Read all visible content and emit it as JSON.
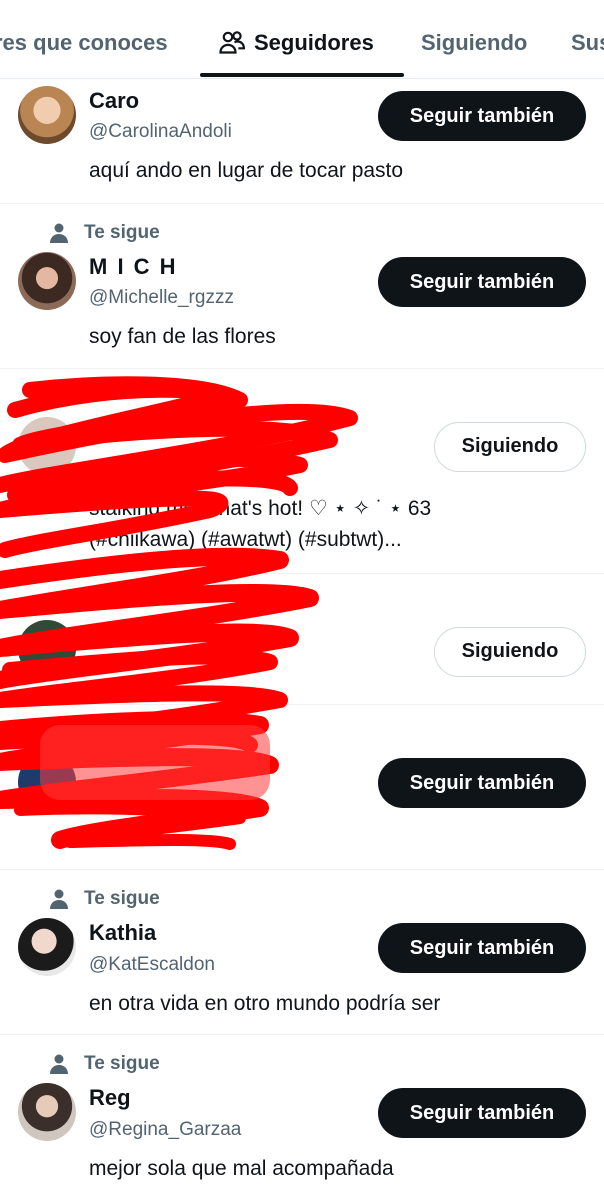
{
  "tabs": [
    {
      "label": "res que conoces"
    },
    {
      "label": "Seguidores",
      "icon": "people-icon",
      "selected": true
    },
    {
      "label": "Siguiendo"
    },
    {
      "label": "Sus"
    }
  ],
  "follows_you_label": "Te sigue",
  "rows": [
    {
      "name": "Caro",
      "handle": "@CarolinaAndoli",
      "button": "Seguir también",
      "bio": "aquí ando en lugar de tocar pasto"
    },
    {
      "follows_you": "Te sigue",
      "name": "M I C H",
      "handle": "@Michelle_rgzzz",
      "button": "Seguir también",
      "bio": "soy fan de las flores"
    },
    {
      "redacted": true,
      "button": "Siguiendo",
      "bio_line1": "stalking me? that's hot! ♡ ⋆ ✧ ˙ ⋆ 63",
      "bio_line2": "(#chiikawa) (#awatwt) (#subtwt)..."
    },
    {
      "redacted": true,
      "button": "Siguiendo"
    },
    {
      "redacted": true,
      "button": "Seguir también"
    },
    {
      "follows_you": "Te sigue",
      "name": "Kathia",
      "handle": "@KatEscaldon",
      "button": "Seguir también",
      "bio": "en otra vida en otro mundo podría ser"
    },
    {
      "follows_you": "Te sigue",
      "name": "Reg",
      "handle": "@Regina_Garzaa",
      "button": "Seguir también",
      "bio": "mejor sola que mal acompañada"
    }
  ],
  "colors": {
    "text": "#0f1419",
    "secondary": "#536471",
    "button_dark": "#0f1419",
    "divider": "#eff3f4",
    "redaction": "#ff0000"
  }
}
